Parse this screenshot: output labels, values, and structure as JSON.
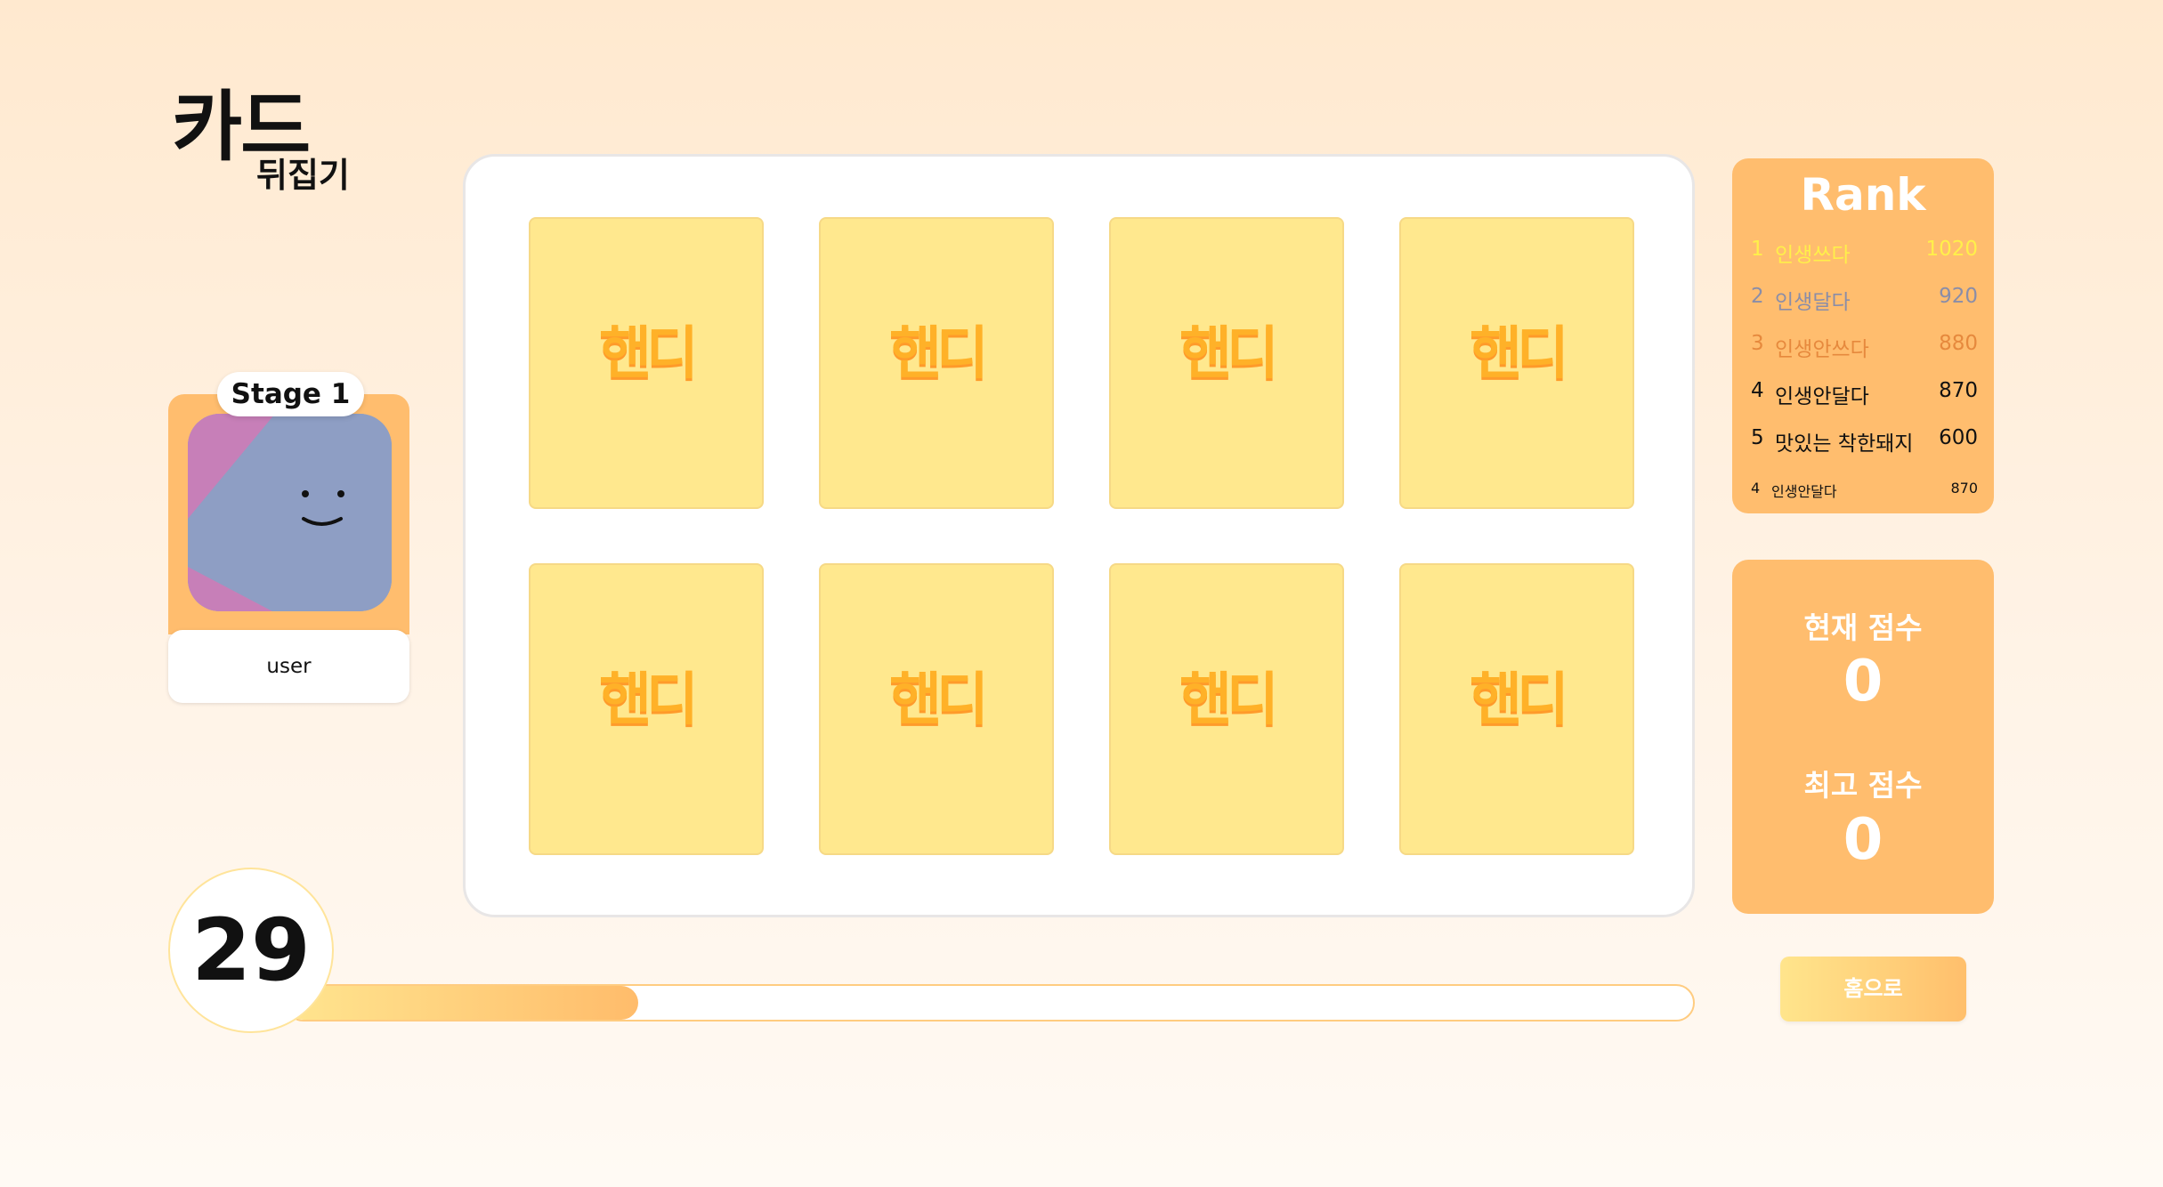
{
  "title": {
    "main": "카드",
    "sub": "뒤집기"
  },
  "player": {
    "stage": "Stage 1",
    "username": "user"
  },
  "cards": [
    {
      "label": "핸디"
    },
    {
      "label": "핸디"
    },
    {
      "label": "핸디"
    },
    {
      "label": "핸디"
    },
    {
      "label": "핸디"
    },
    {
      "label": "핸디"
    },
    {
      "label": "핸디"
    },
    {
      "label": "핸디"
    }
  ],
  "timer": {
    "value": "29",
    "progress": 0.25
  },
  "rank": {
    "title": "Rank",
    "entries": [
      {
        "rank": "1",
        "name": "인생쓰다",
        "score": "1020",
        "color": "#fff04a"
      },
      {
        "rank": "2",
        "name": "인생달다",
        "score": "920",
        "color": "#8a8da8"
      },
      {
        "rank": "3",
        "name": "인생안쓰다",
        "score": "880",
        "color": "#e6893d"
      },
      {
        "rank": "4",
        "name": "인생안달다",
        "score": "870",
        "color": "#111111"
      },
      {
        "rank": "5",
        "name": "맛있는 착한돼지",
        "score": "600",
        "color": "#111111"
      }
    ],
    "me": {
      "rank": "4",
      "name": "인생안달다",
      "score": "870"
    }
  },
  "scores": {
    "current_label": "현재 점수",
    "current_value": "0",
    "best_label": "최고 점수",
    "best_value": "0"
  },
  "home_button": "홈으로",
  "colors": {
    "accent": "#ffbd6e",
    "card": "#ffe88e",
    "card_text": "#ffb128"
  }
}
